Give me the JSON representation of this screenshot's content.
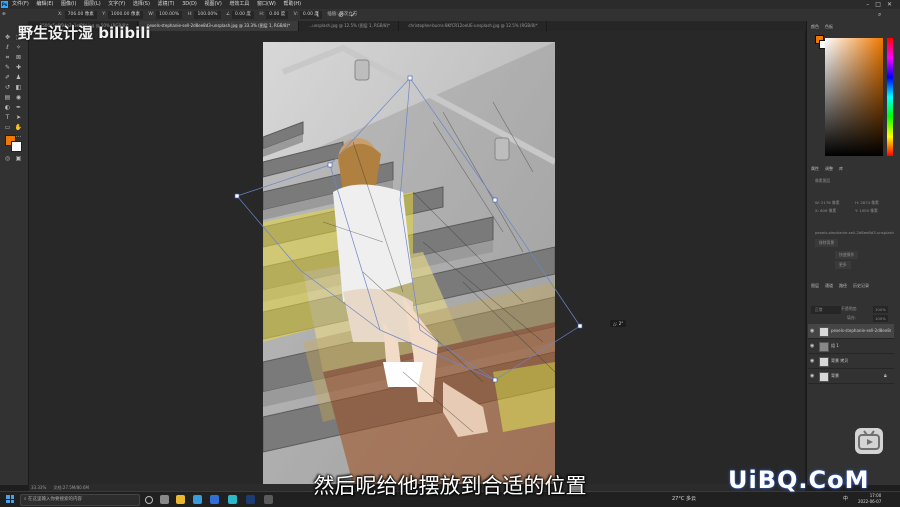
{
  "app": {
    "logo_text": "Ps"
  },
  "menu": [
    "文件(F)",
    "编辑(E)",
    "图像(I)",
    "图层(L)",
    "文字(Y)",
    "选择(S)",
    "滤镜(T)",
    "3D(D)",
    "视图(V)",
    "增效工具",
    "窗口(W)",
    "帮助(H)"
  ],
  "options_bar": {
    "fields": [
      {
        "label": "X:",
        "value": "706.00 像素"
      },
      {
        "label": "Y:",
        "value": "1000.00 像素"
      },
      {
        "label": "W:",
        "value": "100.00%"
      },
      {
        "label": "H:",
        "value": "100.00%"
      },
      {
        "label": "∠",
        "value": "0.00 度"
      },
      {
        "label": "H:",
        "value": "0.00 度"
      },
      {
        "label": "V:",
        "value": "0.00 度"
      }
    ],
    "interp": "插值: 两次立方"
  },
  "doc_tabs": [
    {
      "label": "...1500a5e6f94a2e1ef8fd.jpg @ 50% (RGB/8)*",
      "active": false
    },
    {
      "label": "pexels-stephanie-sell-2d8ee8d3-unsplash.jpg @ 33.3% (图层 1, RGB/8)*",
      "active": true
    },
    {
      "label": "...unsplash.jpg @ 12.5% (图层 1, RGB/8)*",
      "active": false
    },
    {
      "label": "christopher-burns-8KfCR12oeUE-unsplash.jpg @ 12.5% (RGB/8)*",
      "active": false
    }
  ],
  "tools": [
    "move-icon",
    "marquee-icon",
    "lasso-icon",
    "magic-wand-icon",
    "crop-icon",
    "frame-icon",
    "eyedropper-icon",
    "healing-icon",
    "brush-icon",
    "stamp-icon",
    "history-brush-icon",
    "eraser-icon",
    "gradient-icon",
    "blur-icon",
    "dodge-icon",
    "pen-icon",
    "type-icon",
    "path-select-icon",
    "rectangle-icon",
    "hand-icon",
    "zoom-icon",
    "edit-toolbar-icon"
  ],
  "colors": {
    "foreground": "#f07800",
    "background": "#ffffff",
    "accent": "#31a8ff"
  },
  "panels": {
    "color_tabs": [
      "颜色",
      "色板"
    ],
    "properties_tabs": [
      "属性",
      "调整",
      "库"
    ],
    "properties": {
      "kind": "像素图层",
      "w_label": "W:",
      "w_value": "2176 像素",
      "h_label": "H:",
      "h_value": "2874 像素",
      "x_label": "X:",
      "x_value": "606 像素",
      "y_label": "Y:",
      "y_value": "1000 像素",
      "filename": "pexels-stephanie-sell-2d8ee8d3-unsplash",
      "button1": "移除背景",
      "button2": "快速操作",
      "button3": "更多"
    },
    "layers_tabs": [
      "图层",
      "通道",
      "路径",
      "历史记录"
    ],
    "blend_mode": "正常",
    "opacity_label": "不透明度:",
    "opacity": "100%",
    "fill_label": "填充:",
    "fill": "100%",
    "layers": [
      {
        "name": "pexels-stephanie-sell-2d8ee8d3",
        "visible": true
      },
      {
        "name": "组 1",
        "visible": true
      },
      {
        "name": "背景 拷贝",
        "visible": true
      },
      {
        "name": "背景",
        "visible": true
      }
    ]
  },
  "status_bar": {
    "zoom": "33.33%",
    "doc": "文档:27.5M/80.6M"
  },
  "taskbar": {
    "search_placeholder": "在这里输入你要搜索的内容",
    "weather": "27°C 多云",
    "time": "17:00",
    "date": "2022-06-07",
    "lang": "中"
  },
  "overlays": {
    "watermark_left": "野生设计湿 bilibili",
    "watermark_right": "UiBQ.CoM",
    "subtitle": "然后呢给他摆放到合适的位置",
    "transform_readout": "△: 2°"
  }
}
